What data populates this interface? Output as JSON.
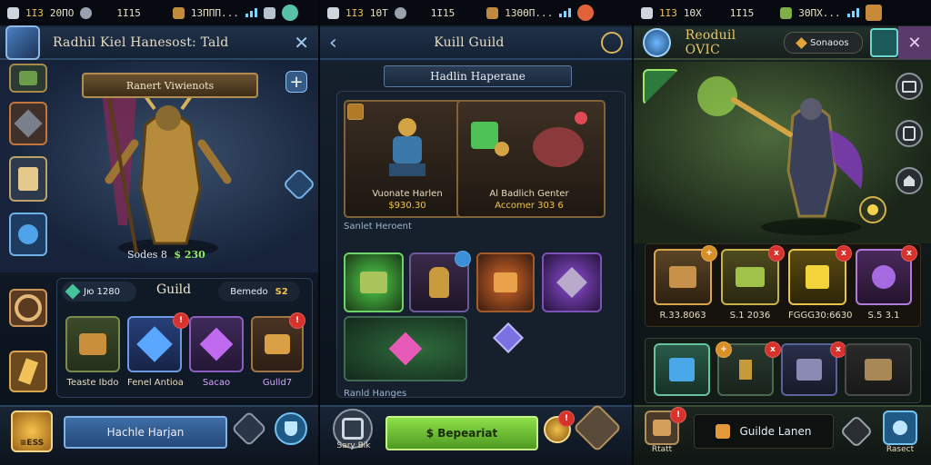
{
  "screen1": {
    "status": {
      "left_a": "1ΙЗ",
      "left_b": "20ΠΟ",
      "time": "1Ι15",
      "right": "13ΠΠΠ..."
    },
    "title": "Radhil Kiel Hanesost: Tald",
    "banner": "Ranert Viwienots",
    "hero_stats": {
      "label": "Sodes 8",
      "value": "$ 230"
    },
    "guild": {
      "gem_value": "Jю 1280",
      "title": "Guild",
      "rank_label": "Bemedo",
      "rank_value": "S2"
    },
    "items": [
      {
        "label": "Teaste Ibdo"
      },
      {
        "label": "Fenel Antioa"
      },
      {
        "label": "Sacao"
      },
      {
        "label": "Gulld7"
      }
    ],
    "bottom_button": "Hachle Harjan",
    "bottom_left_label": "≡ESS"
  },
  "screen2": {
    "status": {
      "left_a": "1ΙЗ",
      "left_b": "1ΘΤ",
      "time": "1Ι15",
      "right": "1ЗΘΘΠ..."
    },
    "title": "Kuill Guild",
    "banner": "Hadlin Haperane",
    "cards": [
      {
        "title": "Vuonate Harlen",
        "value": "$930.30"
      },
      {
        "title": "Al Badlich Genter",
        "value": "Accomer 303 6"
      }
    ],
    "section1": "Sanlet Heroent",
    "section2": "Ranld Hanges",
    "cta": "$ Bepeariat",
    "bottom_left_label": "Sary Bik"
  },
  "screen3": {
    "status": {
      "left_a": "1ΙЗ",
      "left_b": "1ΘΧ",
      "time": "1Ι15",
      "right": "ЗΘΠΧ..."
    },
    "title": "Reoduil OVIC",
    "top_pill": "Sonaoos",
    "items": [
      {
        "label": "R.33.8063"
      },
      {
        "label": "S.1 2036"
      },
      {
        "label": "FGGG30:6630"
      },
      {
        "label": "S.5 3.1"
      }
    ],
    "cta": "Guilde Lanen",
    "bottom_left_label": "Rtatt",
    "bottom_right_label": "Rasect"
  },
  "colors": {
    "gold": "#f3c44d",
    "green_button": "#7fce3a",
    "blue_button": "#3e6ea6",
    "red_badge": "#d8322c"
  }
}
